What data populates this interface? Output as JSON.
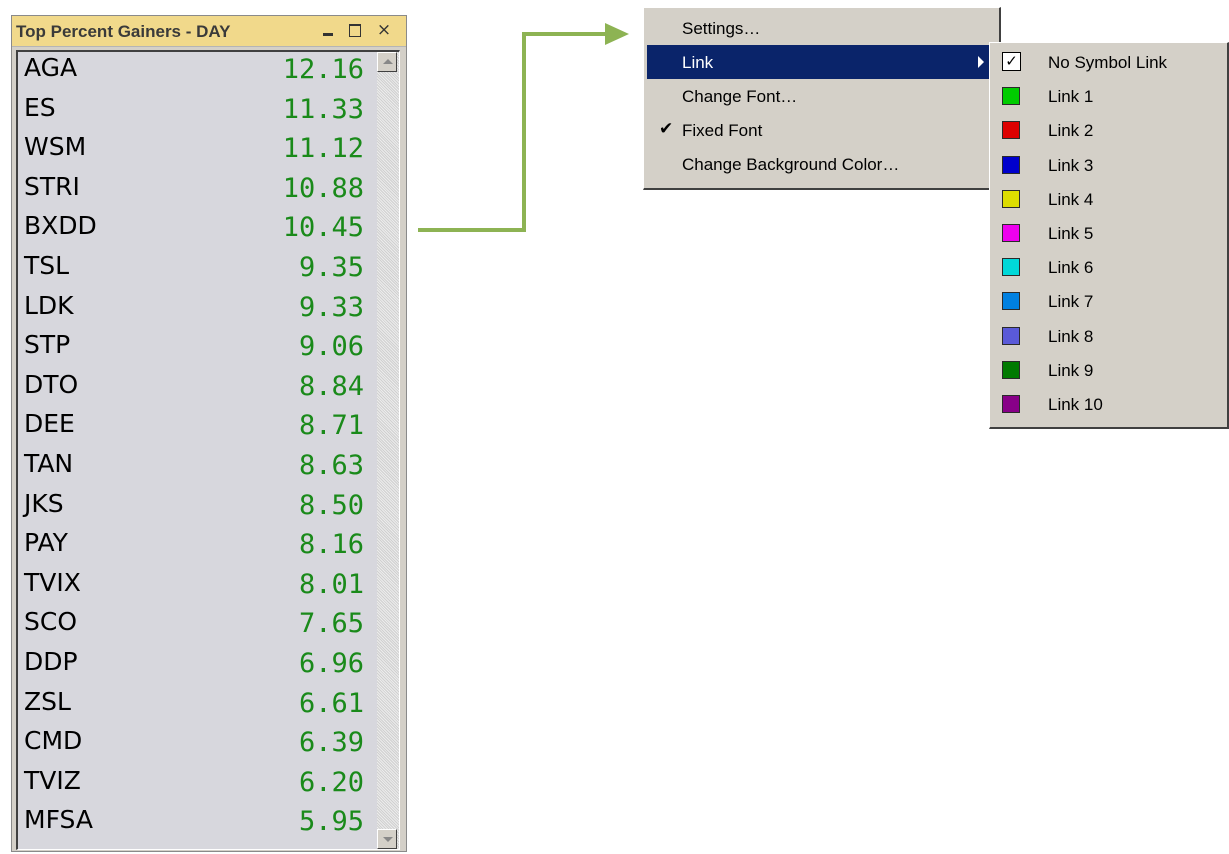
{
  "window": {
    "title": "Top Percent Gainers - DAY",
    "controls": {
      "minimize": "minimize-icon",
      "maximize": "maximize-icon",
      "close": "×"
    }
  },
  "gainers": [
    {
      "symbol": "AGA",
      "value": "12.16"
    },
    {
      "symbol": "ES",
      "value": "11.33"
    },
    {
      "symbol": "WSM",
      "value": "11.12"
    },
    {
      "symbol": "STRI",
      "value": "10.88"
    },
    {
      "symbol": "BXDD",
      "value": "10.45"
    },
    {
      "symbol": "TSL",
      "value": "9.35"
    },
    {
      "symbol": "LDK",
      "value": "9.33"
    },
    {
      "symbol": "STP",
      "value": "9.06"
    },
    {
      "symbol": "DTO",
      "value": "8.84"
    },
    {
      "symbol": "DEE",
      "value": "8.71"
    },
    {
      "symbol": "TAN",
      "value": "8.63"
    },
    {
      "symbol": "JKS",
      "value": "8.50"
    },
    {
      "symbol": "PAY",
      "value": "8.16"
    },
    {
      "symbol": "TVIX",
      "value": "8.01"
    },
    {
      "symbol": "SCO",
      "value": "7.65"
    },
    {
      "symbol": "DDP",
      "value": "6.96"
    },
    {
      "symbol": "ZSL",
      "value": "6.61"
    },
    {
      "symbol": "CMD",
      "value": "6.39"
    },
    {
      "symbol": "TVIZ",
      "value": "6.20"
    },
    {
      "symbol": "MFSA",
      "value": "5.95"
    }
  ],
  "colors": {
    "value_text": "#1a8a1a",
    "title_bar": "#f1d98b",
    "menu_highlight": "#0a246a",
    "connector": "#8db353"
  },
  "context_menu": {
    "items": [
      {
        "label": "Settings…",
        "checked": false,
        "highlight": false,
        "submenu": false
      },
      {
        "label": "Link",
        "checked": false,
        "highlight": true,
        "submenu": true
      },
      {
        "label": "Change Font…",
        "checked": false,
        "highlight": false,
        "submenu": false
      },
      {
        "label": "Fixed Font",
        "checked": true,
        "highlight": false,
        "submenu": false
      },
      {
        "label": "Change Background Color…",
        "checked": false,
        "highlight": false,
        "submenu": false
      }
    ],
    "check_glyph": "✔"
  },
  "link_submenu": {
    "items": [
      {
        "label": "No Symbol Link",
        "type": "checkbox",
        "checked": true,
        "glyph": "✓"
      },
      {
        "label": "Link 1",
        "type": "swatch",
        "color": "#00cc00"
      },
      {
        "label": "Link 2",
        "type": "swatch",
        "color": "#dd0000"
      },
      {
        "label": "Link 3",
        "type": "swatch",
        "color": "#0000cc"
      },
      {
        "label": "Link 4",
        "type": "swatch",
        "color": "#dddd00"
      },
      {
        "label": "Link 5",
        "type": "swatch",
        "color": "#ee00ee"
      },
      {
        "label": "Link 6",
        "type": "swatch",
        "color": "#00d8d8"
      },
      {
        "label": "Link 7",
        "type": "swatch",
        "color": "#0080e0"
      },
      {
        "label": "Link 8",
        "type": "swatch",
        "color": "#5a5ad8"
      },
      {
        "label": "Link 9",
        "type": "swatch",
        "color": "#007a00"
      },
      {
        "label": "Link 10",
        "type": "swatch",
        "color": "#880088"
      }
    ]
  }
}
